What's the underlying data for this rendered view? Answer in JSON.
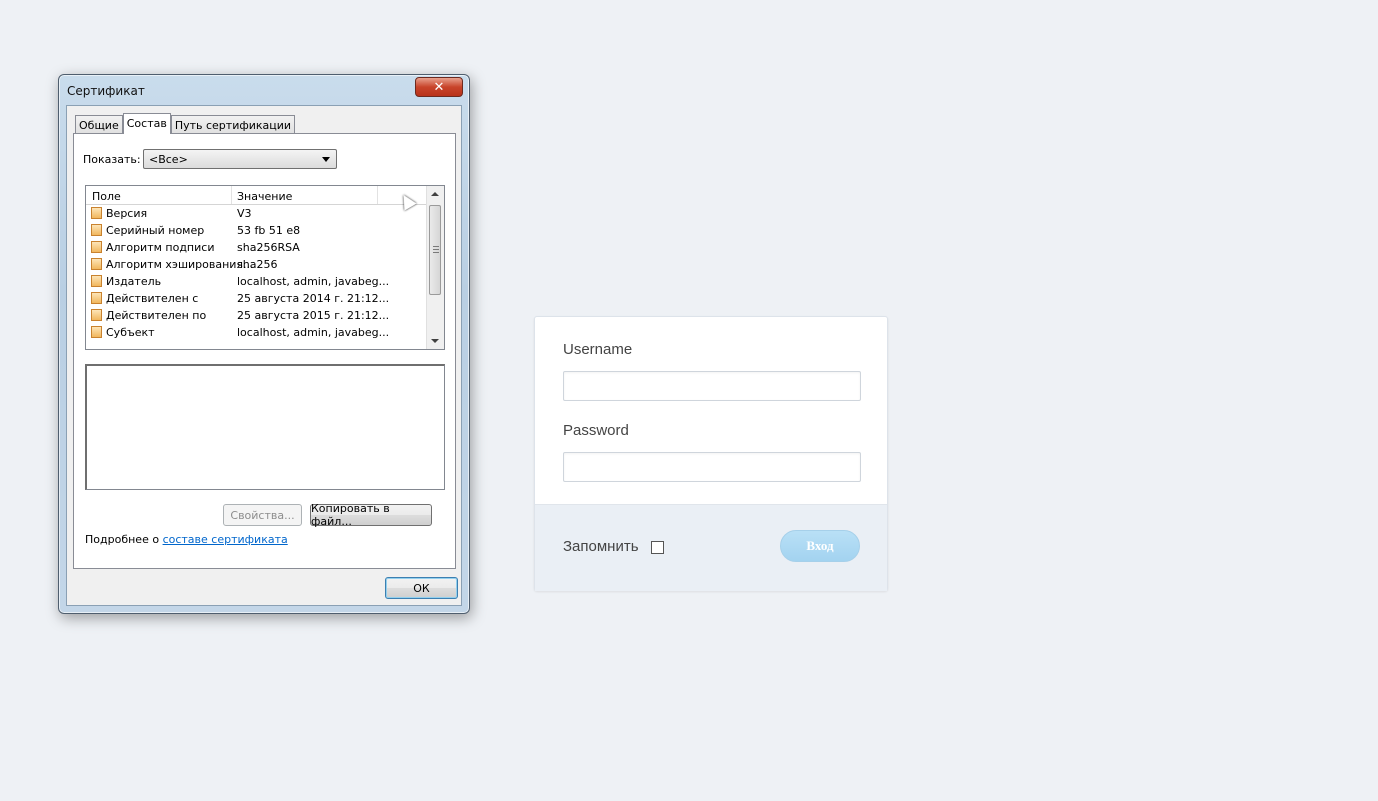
{
  "dialog": {
    "title": "Сертификат",
    "close_glyph": "✕",
    "tabs": [
      {
        "label": "Общие",
        "active": false
      },
      {
        "label": "Состав",
        "active": true
      },
      {
        "label": "Путь сертификации",
        "active": false
      }
    ],
    "show_label": "Показать:",
    "show_value": "<Все>",
    "columns": {
      "field": "Поле",
      "value": "Значение"
    },
    "rows": [
      {
        "field": "Версия",
        "value": "V3"
      },
      {
        "field": "Серийный номер",
        "value": "53 fb 51 e8"
      },
      {
        "field": "Алгоритм подписи",
        "value": "sha256RSA"
      },
      {
        "field": "Алгоритм хэширования...",
        "value": "sha256"
      },
      {
        "field": "Издатель",
        "value": "localhost, admin, javabeg..."
      },
      {
        "field": "Действителен с",
        "value": "25 августа 2014 г. 21:12..."
      },
      {
        "field": "Действителен по",
        "value": "25 августа 2015 г. 21:12..."
      },
      {
        "field": "Субъект",
        "value": "localhost, admin, javabeg..."
      }
    ],
    "properties_button": "Свойства...",
    "copy_button": "Копировать в файл...",
    "more_prefix": "Подробнее о ",
    "more_link": "составе сертификата",
    "ok_button": "ОК"
  },
  "login": {
    "username_label": "Username",
    "password_label": "Password",
    "username_value": "",
    "password_value": "",
    "remember_label": "Запомнить",
    "remember_checked": false,
    "submit_label": "Вход",
    "colors": {
      "background": "#eef1f5",
      "footer": "#eaeff5",
      "button": "#a9d6f1"
    }
  }
}
